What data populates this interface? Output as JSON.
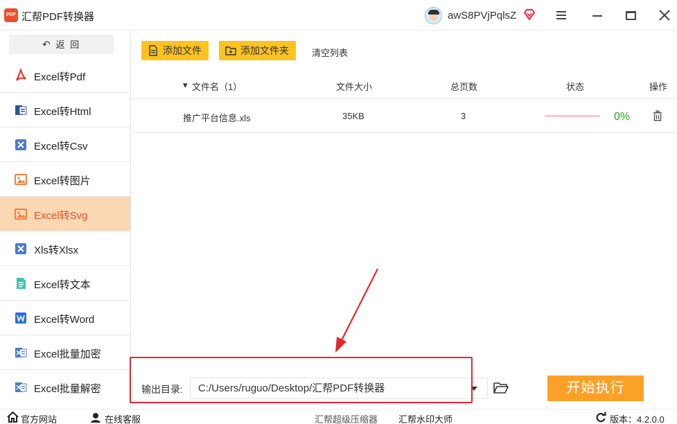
{
  "app": {
    "title": "汇帮PDF转换器",
    "logo_text": "PDF"
  },
  "user": {
    "name": "awS8PVjPqlsZ"
  },
  "sidebar": {
    "back_label": "返 回",
    "items": [
      {
        "label": "Excel转Pdf",
        "icon": "pdf-icon"
      },
      {
        "label": "Excel转Html",
        "icon": "html-file-icon"
      },
      {
        "label": "Excel转Csv",
        "icon": "excel-icon"
      },
      {
        "label": "Excel转图片",
        "icon": "image-icon"
      },
      {
        "label": "Excel转Svg",
        "icon": "image-icon",
        "active": true
      },
      {
        "label": "Xls转Xlsx",
        "icon": "excel-icon"
      },
      {
        "label": "Excel转文本",
        "icon": "text-file-icon"
      },
      {
        "label": "Excel转Word",
        "icon": "word-icon"
      },
      {
        "label": "Excel批量加密",
        "icon": "excel-lock-icon"
      },
      {
        "label": "Excel批量解密",
        "icon": "excel-unlock-icon"
      }
    ]
  },
  "toolbar": {
    "add_file": "添加文件",
    "add_folder": "添加文件夹",
    "clear_list": "清空列表"
  },
  "table": {
    "headers": {
      "name": "文件名（1）",
      "size": "文件大小",
      "pages": "总页数",
      "status": "状态",
      "action": "操作"
    },
    "rows": [
      {
        "name": "推广平台信息.xls",
        "size": "35KB",
        "pages": "3",
        "progress": 0,
        "progress_text": "0%"
      }
    ]
  },
  "output": {
    "label": "输出目录:",
    "path": "C:/Users/ruguo/Desktop/汇帮PDF转换器"
  },
  "start_button": "开始执行",
  "statusbar": {
    "website": "官方网站",
    "support": "在线客服",
    "product1": "汇帮超级压缩器",
    "product2": "汇帮水印大师",
    "version": "版本：4.2.0.0"
  },
  "colors": {
    "accent": "#fcc21f",
    "start": "#fba127",
    "active_bg": "#fbd7b3",
    "active_text": "#e8502d",
    "annotation": "#e4262b",
    "progress_text": "#1ea820"
  }
}
